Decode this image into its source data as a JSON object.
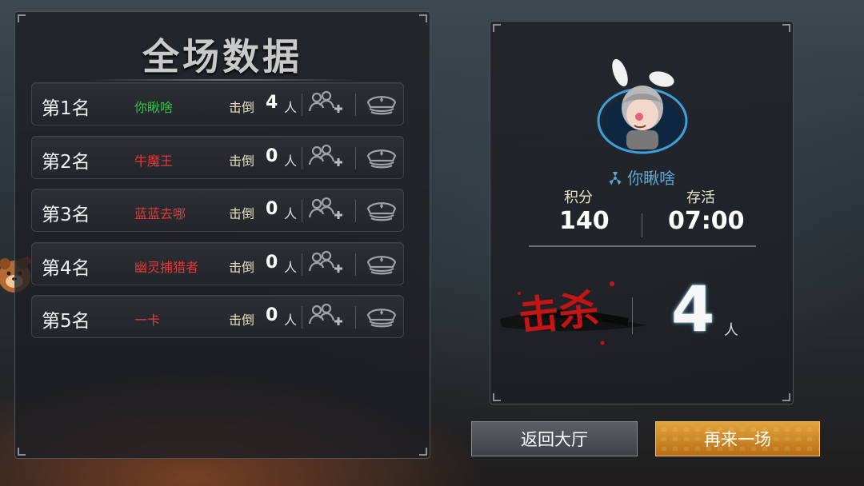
{
  "scoreboard": {
    "title": "全场数据",
    "kill_label": "击倒",
    "unit": "人",
    "rows": [
      {
        "rank": "第1名",
        "name": "你瞅啥",
        "kills": "4",
        "name_color": "#35c04a"
      },
      {
        "rank": "第2名",
        "name": "牛魔王",
        "kills": "0",
        "name_color": "#e23a3a"
      },
      {
        "rank": "第3名",
        "name": "蓝蓝去哪",
        "kills": "0",
        "name_color": "#e23a3a"
      },
      {
        "rank": "第4名",
        "name": "幽灵捕猎者",
        "kills": "0",
        "name_color": "#e23a3a"
      },
      {
        "rank": "第5名",
        "name": "一卡",
        "kills": "0",
        "name_color": "#e23a3a"
      }
    ]
  },
  "player": {
    "name": "你瞅啥",
    "score_label": "积分",
    "score": "140",
    "survive_label": "存活",
    "survive_time": "07:00",
    "kill_title": "击杀",
    "kills": "4",
    "kills_unit": "人"
  },
  "buttons": {
    "lobby": "返回大厅",
    "again": "再来一场"
  },
  "icons": {
    "add_friend": "add-friend-icon",
    "police": "police-cap-icon",
    "radiation": "radiation-icon"
  }
}
